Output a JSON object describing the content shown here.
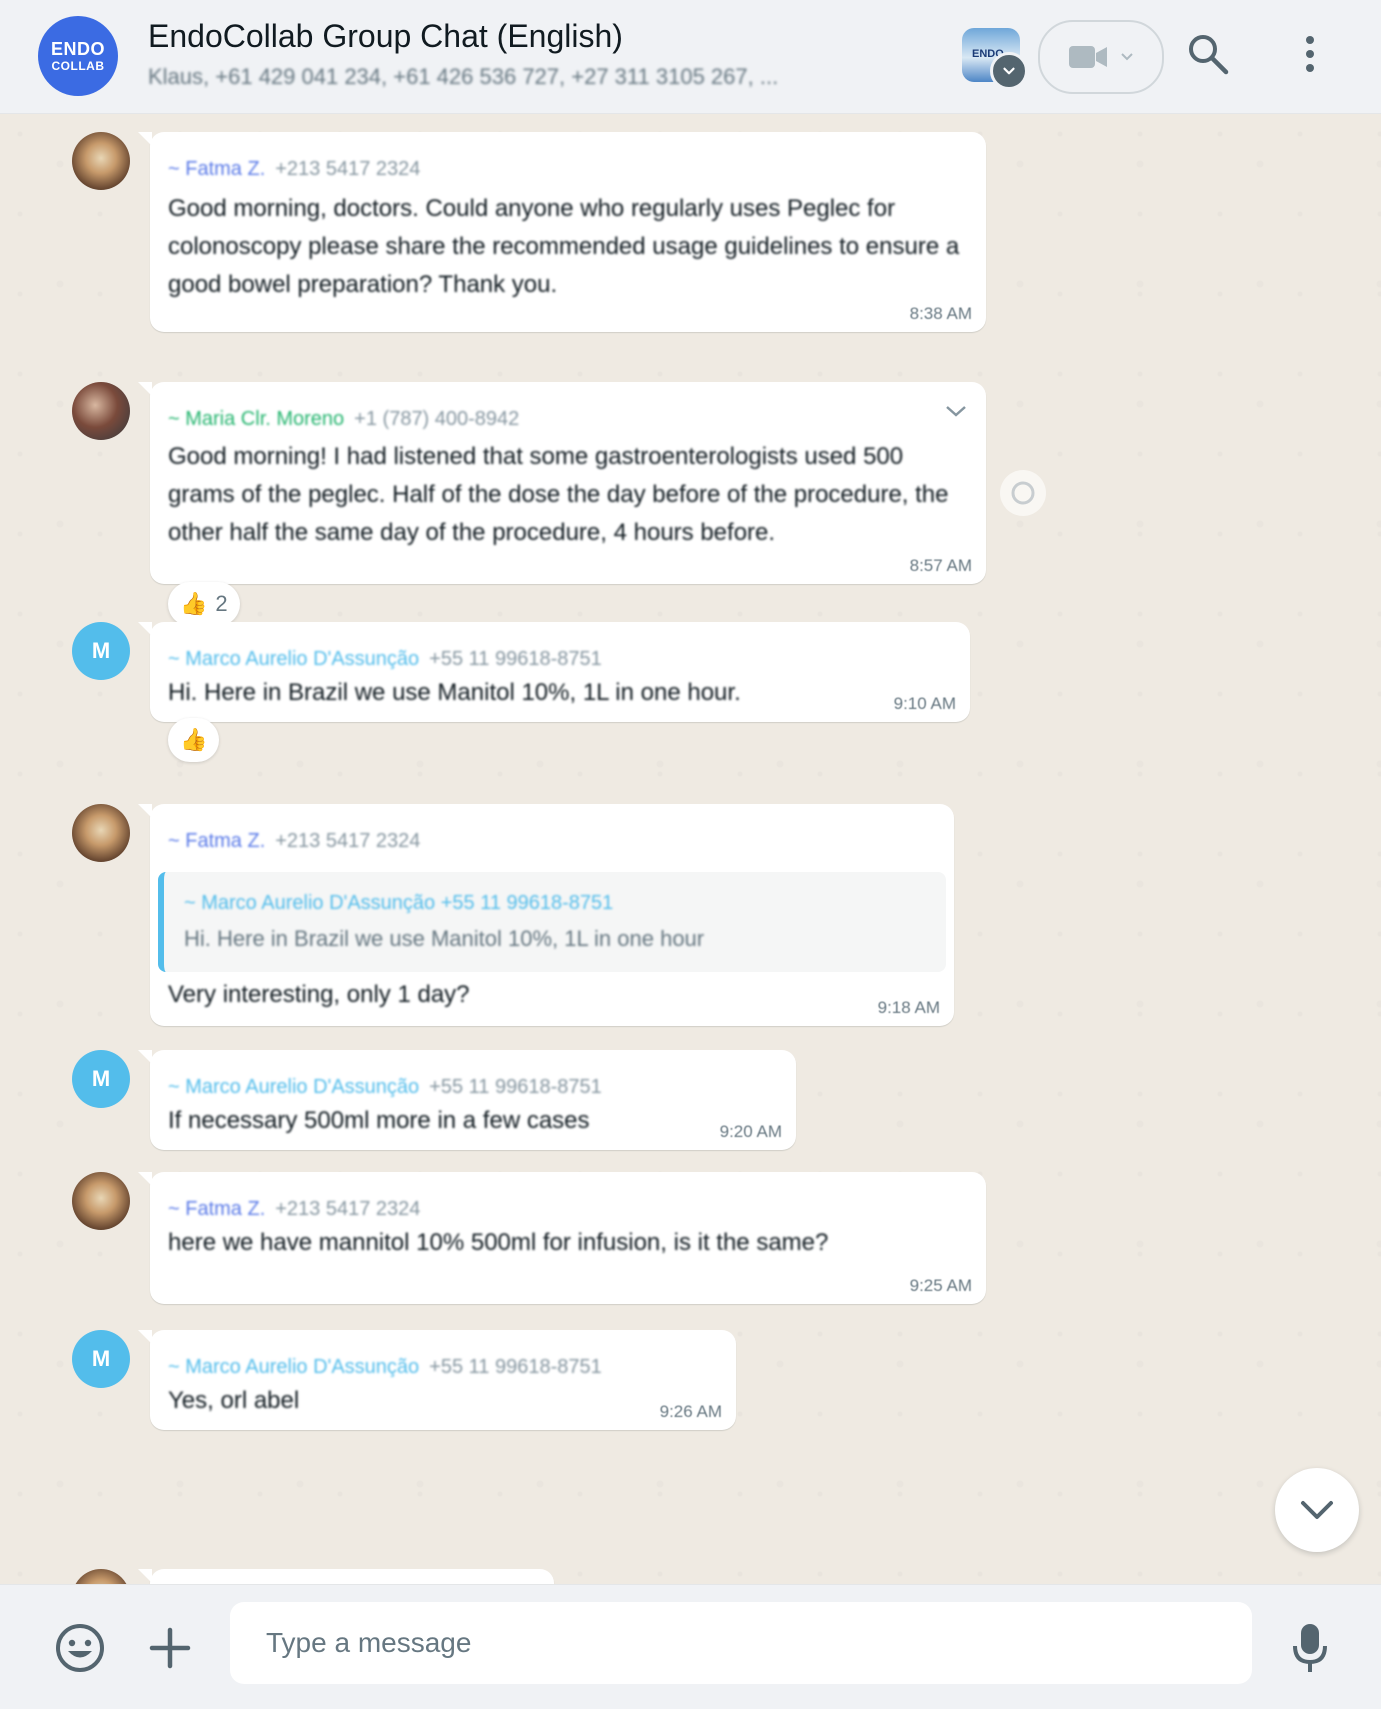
{
  "header": {
    "group_logo_line1": "ENDO",
    "group_logo_line2": "COLLAB",
    "title": "EndoCollab Group Chat (English)",
    "subtitle": "Klaus, +61 429 041 234, +61 426 536 727, +27 311 3105 267, ...",
    "profile_thumb_text": "ENDO",
    "icons": [
      "video-camera-icon",
      "chevron-down-icon",
      "search-icon",
      "menu-dots-icon"
    ]
  },
  "messages": [
    {
      "sender": "~ Fatma Z.",
      "phone": "+213 5417 2324",
      "sender_color": "#5b7be8",
      "text": "Good morning, doctors. Could anyone who regularly uses Peglec for colonoscopy please share the recommended usage guidelines to ensure a good bowel preparation? Thank you.",
      "time": "8:38 AM"
    },
    {
      "sender": "~ Maria Clr. Moreno",
      "phone": "+1 (787) 400-8942",
      "sender_color": "#25b56f",
      "text": "Good morning! I had listened that some gastroenterologists used 500 grams of the peglec. Half of the dose the day before of the procedure, the other half the same day of the procedure, 4 hours before.",
      "time": "8:57 AM",
      "reaction_emoji": "👍",
      "reaction_count": "2"
    },
    {
      "sender": "~ Marco Aurelio D'Assunção",
      "phone": "+55 11 99618-8751",
      "sender_color": "#53bdeb",
      "text": "Hi. Here in Brazil we use Manitol 10%, 1L in one hour.",
      "time": "9:10 AM",
      "reaction_emoji": "👍"
    },
    {
      "sender": "~ Fatma Z.",
      "phone": "+213 5417 2324",
      "sender_color": "#5b7be8",
      "quote_sender": "~ Marco Aurelio D'Assunção +55 11 99618-8751",
      "quote_text": "Hi. Here in Brazil we use Manitol 10%, 1L in one hour",
      "text": "Very interesting, only 1 day?",
      "time": "9:18 AM"
    },
    {
      "sender": "~ Marco Aurelio D'Assunção",
      "phone": "+55 11 99618-8751",
      "sender_color": "#53bdeb",
      "text": "If necessary 500ml more in a few cases",
      "time": "9:20 AM"
    },
    {
      "sender": "~ Fatma Z.",
      "phone": "+213 5417 2324",
      "sender_color": "#5b7be8",
      "text": "here we have mannitol 10% 500ml for infusion, is it the same?",
      "time": "9:25 AM"
    },
    {
      "sender": "~ Marco Aurelio D'Assunção",
      "phone": "+55 11 99618-8751",
      "sender_color": "#53bdeb",
      "text": "Yes, orl abel",
      "time": "9:26 AM"
    }
  ],
  "composer": {
    "placeholder": "Type a message",
    "icons": [
      "emoji-icon",
      "plus-icon",
      "microphone-icon"
    ]
  },
  "colors": {
    "header_bg": "#f0f2f5",
    "chat_bg": "#efeae2",
    "bubble_bg": "#ffffff",
    "avatar_brand": "#3b6be3",
    "initial_avatar": "#53bdeb"
  }
}
